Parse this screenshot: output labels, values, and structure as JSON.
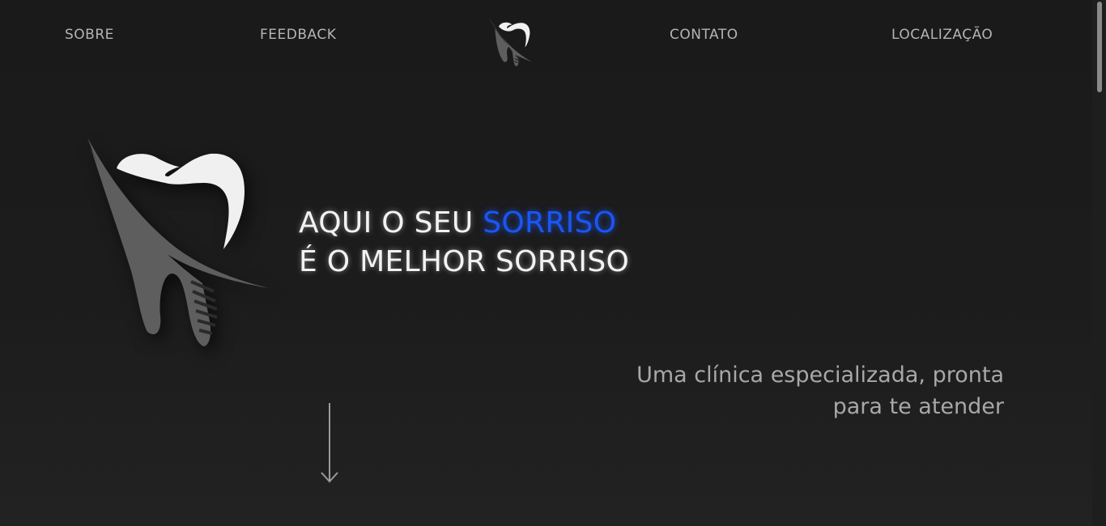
{
  "nav": {
    "items": [
      {
        "label": "SOBRE"
      },
      {
        "label": "FEEDBACK"
      },
      {
        "label": "CONTATO"
      },
      {
        "label": "LOCALIZAÇÃO"
      }
    ],
    "logo_icon": "tooth-implant-logo-icon"
  },
  "hero": {
    "logo_icon": "tooth-implant-logo-icon",
    "headline_line1_prefix": "AQUI O SEU ",
    "headline_line1_accent": "SORRISO",
    "headline_line2": "É O MELHOR SORRISO",
    "subtitle_line1": "Uma clínica especializada, pronta",
    "subtitle_line2": "para te atender",
    "scroll_icon": "arrow-down-icon"
  },
  "colors": {
    "background": "#1b1b1b",
    "accent": "#1a56f5",
    "text": "#f2f2f2",
    "nav_text": "#b4b4b4",
    "logo_gray": "#5e5e5e",
    "logo_white": "#f0f0f0"
  }
}
